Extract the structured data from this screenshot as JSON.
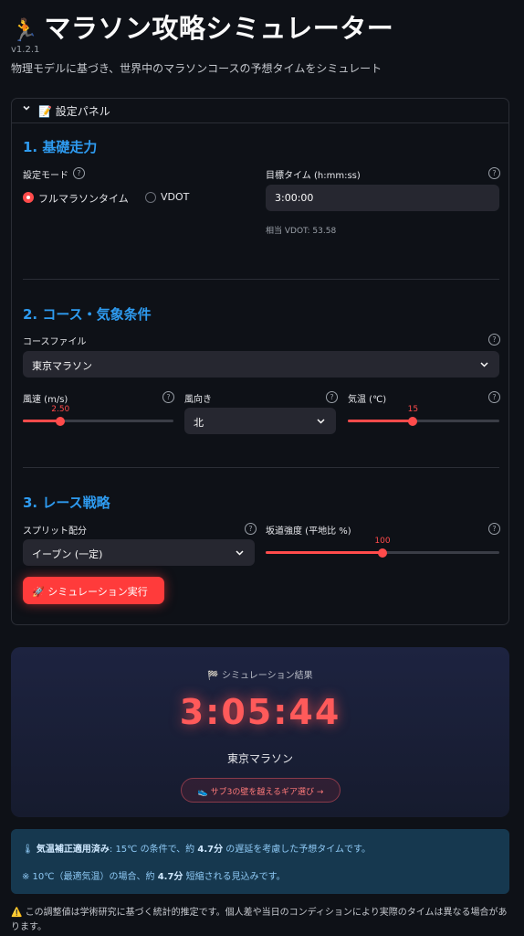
{
  "header": {
    "title": "マラソン攻略シミュレーター",
    "title_icon": "🏃",
    "version": "v1.2.1",
    "subtitle": "物理モデルに基づき、世界中のマラソンコースの予想タイムをシミュレート"
  },
  "panel": {
    "title": "📝 設定パネル",
    "expanded": true
  },
  "section1": {
    "heading": "1. 基礎走力",
    "mode_label": "設定モード",
    "mode_options": [
      "フルマラソンタイム",
      "VDOT"
    ],
    "mode_selected": "フルマラソンタイム",
    "target_label": "目標タイム (h:mm:ss)",
    "target_value": "3:00:00",
    "vdot_hint": "相当 VDOT: 53.58"
  },
  "section2": {
    "heading": "2. コース・気象条件",
    "course_label": "コースファイル",
    "course_value": "東京マラソン",
    "wind_speed_label": "風速 (m/s)",
    "wind_speed_value": "2.50",
    "wind_speed_fraction": 0.25,
    "wind_dir_label": "風向き",
    "wind_dir_value": "北",
    "temp_label": "気温 (℃)",
    "temp_value": "15",
    "temp_fraction": 0.43
  },
  "section3": {
    "heading": "3. レース戦略",
    "split_label": "スプリット配分",
    "split_value": "イーブン (一定)",
    "slope_label": "坂道強度 (平地比 %)",
    "slope_value": "100",
    "slope_fraction": 0.5,
    "run_button": "🚀 シミュレーション実行"
  },
  "result": {
    "heading": "🏁 シミュレーション結果",
    "time": "3:05:44",
    "course": "東京マラソン",
    "gear_button": "👟 サブ3の壁を越えるギア選び →"
  },
  "info": {
    "line1_icon": "🌡",
    "line1_strong": "気温補正適用済み",
    "line1_a": ": 15℃ の条件で、約 ",
    "line1_value": "4.7分",
    "line1_b": " の遅延を考慮した予想タイムです。",
    "line2_a": "※ 10℃（最適気温）の場合、約 ",
    "line2_value": "4.7分",
    "line2_b": " 短縮される見込みです。"
  },
  "disclaimer": "⚠️ この調整値は学術研究に基づく統計的推定です。個人差や当日のコンディションにより実際のタイムは異なる場合があります。",
  "colors": {
    "accent": "#ff4b4b",
    "heading": "#2e9bf0",
    "background": "#0e1117"
  }
}
